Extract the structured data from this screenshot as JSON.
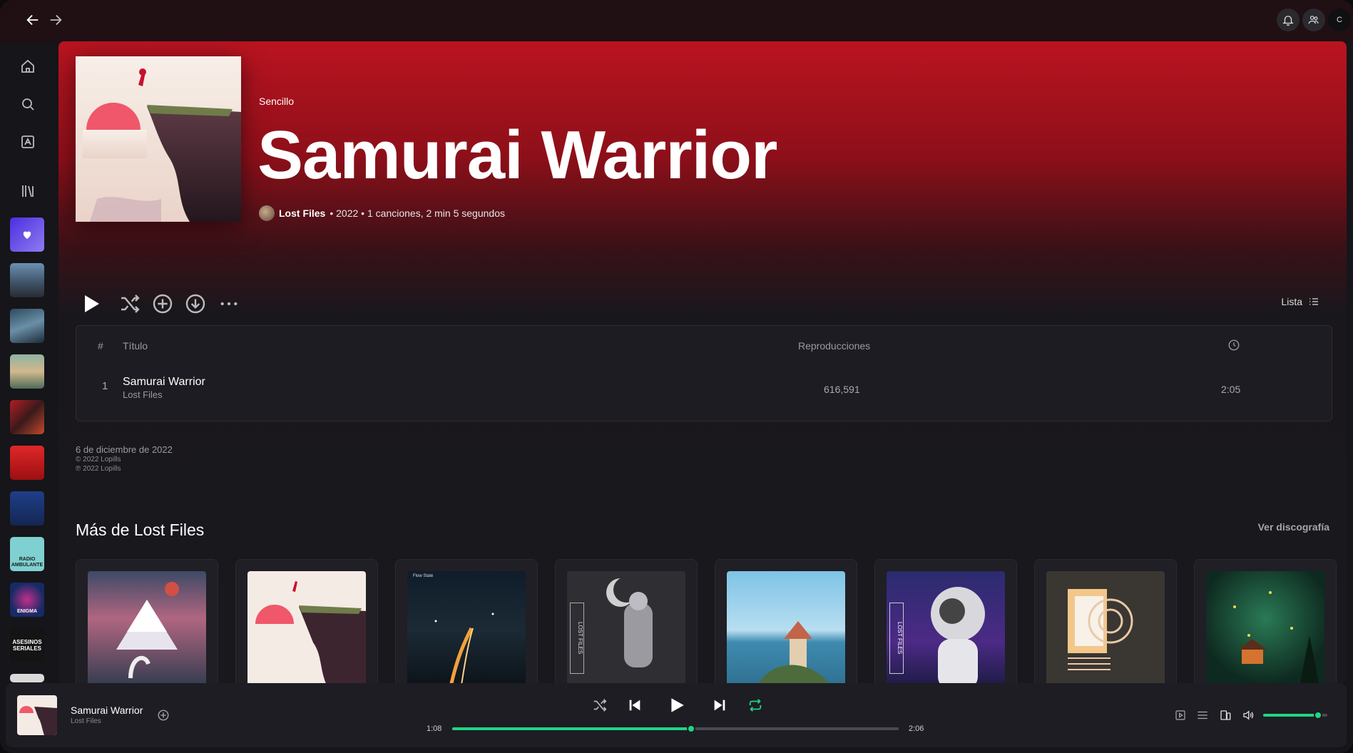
{
  "header": {
    "type_label": "Sencillo",
    "title": "Samurai Warrior",
    "artist": "Lost Files",
    "meta_rest": "• 2022 • 1 canciones, 2 min 5 segundos"
  },
  "controls": {
    "view_label": "Lista"
  },
  "tracks": {
    "columns": {
      "number": "#",
      "title": "Título",
      "plays": "Reproducciones"
    },
    "rows": [
      {
        "number": "1",
        "title": "Samurai Warrior",
        "artist": "Lost Files",
        "plays": "616,591",
        "duration": "2:05"
      }
    ]
  },
  "release": {
    "date": "6 de diciembre de 2022",
    "copyright_c": "© 2022 Lopills",
    "copyright_p": "℗ 2022 Lopills"
  },
  "more": {
    "title": "Más de Lost Files",
    "see_all": "Ver discografía",
    "label_chill": "LOST FILES",
    "label_flow": "Flow State"
  },
  "sidebar": {
    "thumb_radio": "RADIO AMBULANTE",
    "thumb_enigma": "ENIGMA",
    "thumb_asesinos": "ASESINOS SERIALES"
  },
  "player": {
    "title": "Samurai Warrior",
    "artist": "Lost Files",
    "elapsed": "1:08",
    "total": "2:06",
    "progress": 0.535,
    "volume": 0.85
  },
  "top": {
    "avatar_letter": "C"
  },
  "colors": {
    "accent": "#1ed782",
    "header_red": "#ba1420"
  }
}
